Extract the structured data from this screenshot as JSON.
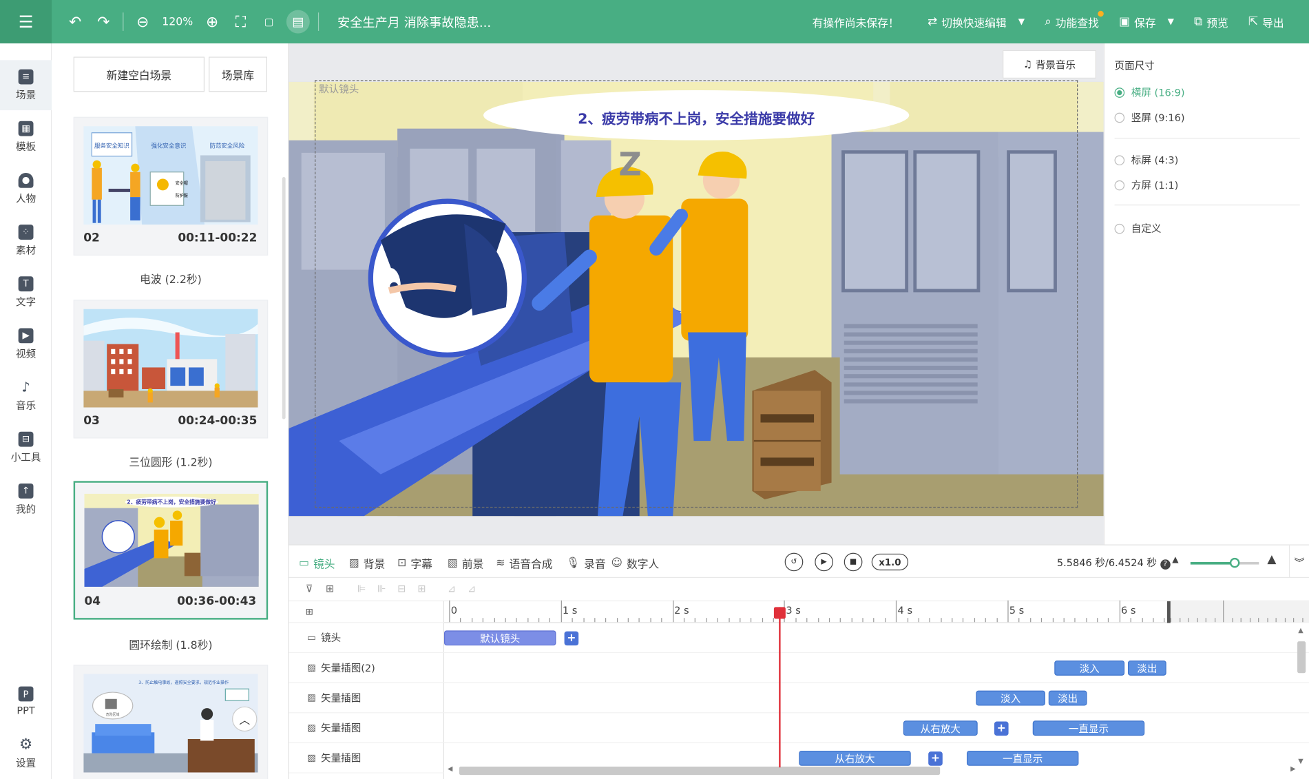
{
  "toolbar": {
    "zoom": "120%",
    "doc_title": "安全生产月 消除事故隐患...",
    "unsaved": "有操作尚未保存！",
    "quick_edit": "切换快速编辑",
    "feature_search": "功能查找",
    "save": "保存",
    "preview": "预览",
    "export": "导出",
    "accent": "#48ae83"
  },
  "nav": {
    "items": [
      {
        "label": "场景",
        "icon": "scene-icon"
      },
      {
        "label": "模板",
        "icon": "template-icon"
      },
      {
        "label": "人物",
        "icon": "person-icon"
      },
      {
        "label": "素材",
        "icon": "material-icon"
      },
      {
        "label": "文字",
        "icon": "text-icon"
      },
      {
        "label": "视频",
        "icon": "video-icon"
      },
      {
        "label": "音乐",
        "icon": "music-icon"
      },
      {
        "label": "小工具",
        "icon": "toolbox-icon"
      },
      {
        "label": "我的",
        "icon": "upload-icon"
      },
      {
        "label": "PPT",
        "icon": "ppt-icon"
      },
      {
        "label": "设置",
        "icon": "gear-icon"
      }
    ]
  },
  "scenes": {
    "new_blank": "新建空白场景",
    "library": "场景库",
    "cards": [
      {
        "num": "02",
        "time": "00:11-00:22",
        "transition": "电波 (2.2秒)"
      },
      {
        "num": "03",
        "time": "00:24-00:35",
        "transition": "三位圆形 (1.2秒)"
      },
      {
        "num": "04",
        "time": "00:36-00:43",
        "transition": "圆环绘制 (1.8秒)"
      }
    ],
    "thumb_texts": {
      "s2_a": "服务安全知识",
      "s2_b": "强化安全意识",
      "s2_c": "防范安全风险",
      "s2_sign": "安全帽",
      "s2_sign2": "防护服",
      "s4_banner": "2、疲劳带病不上岗，安全措施要做好",
      "s5_banner": "3、防止触电事故，遵照安全要求，规范作业操作",
      "s5_box": "危险区域"
    }
  },
  "canvas": {
    "bgm": "背景音乐",
    "lens_label": "默认镜头",
    "banner": "2、疲劳带病不上岗，安全措施要做好",
    "z": "Z"
  },
  "page_size": {
    "title": "页面尺寸",
    "options": [
      {
        "label": "横屏 (16:9)",
        "selected": true
      },
      {
        "label": "竖屏 (9:16)",
        "selected": false
      },
      {
        "label": "标屏 (4:3)",
        "selected": false
      },
      {
        "label": "方屏 (1:1)",
        "selected": false
      },
      {
        "label": "自定义",
        "selected": false
      }
    ]
  },
  "bottom": {
    "tabs": [
      "镜头",
      "背景",
      "字幕",
      "前景",
      "语音合成",
      "录音",
      "数字人"
    ],
    "speed": "x1.0",
    "time": "5.5846 秒/6.4524 秒",
    "zoom_level": 0.65
  },
  "timeline": {
    "ticks": [
      "0",
      "1 s",
      "2 s",
      "3 s",
      "4 s",
      "5 s",
      "6 s"
    ],
    "rows": [
      "镜头",
      "矢量插图(2)",
      "矢量插图",
      "矢量插图",
      "矢量插图"
    ],
    "clips": {
      "lens": "默认镜头",
      "fade_in": "淡入",
      "fade_out": "淡出",
      "zoom_right": "从右放大",
      "always": "一直显示"
    },
    "plus": "+"
  }
}
